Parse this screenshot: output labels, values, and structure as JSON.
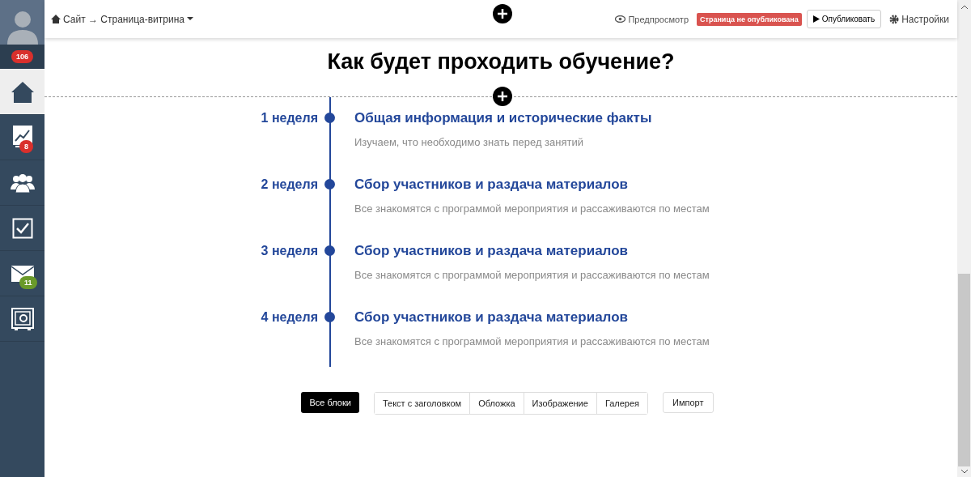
{
  "sidebar": {
    "avatar_badge": "106",
    "items": [
      {
        "kind": "home",
        "selected": true
      },
      {
        "kind": "chart",
        "selected": false,
        "badge": "8",
        "color": "#d9302c"
      },
      {
        "kind": "people",
        "selected": false
      },
      {
        "kind": "tasks",
        "selected": false
      },
      {
        "kind": "mail",
        "selected": false,
        "badge": "11",
        "color": "#6a9a2a"
      },
      {
        "kind": "safe",
        "selected": false
      }
    ]
  },
  "header": {
    "breadcrumb": "Сайт → Страница-витрина",
    "preview": "Предпросмотр",
    "status": "Страница не опубликована",
    "publish": "Опубликовать",
    "settings": "Настройки"
  },
  "section": {
    "title": "Как будет проходить обучение?"
  },
  "timeline": [
    {
      "week": "1 неделя",
      "title": "Общая информация и исторические факты",
      "text": "Изучаем, что необходимо знать перед занятий"
    },
    {
      "week": "2 неделя",
      "title": "Сбор участников и раздача материалов",
      "text": "Все знакомятся с программой мероприятия и рассаживаются по местам"
    },
    {
      "week": "3 неделя",
      "title": "Сбор участников и раздача материалов",
      "text": "Все знакомятся с программой мероприятия и рассаживаются по местам"
    },
    {
      "week": "4 неделя",
      "title": "Сбор участников и раздача материалов",
      "text": "Все знакомятся с программой мероприятия и рассаживаются по местам"
    }
  ],
  "block_filters": [
    {
      "label": "Все блоки",
      "selected": true
    },
    {
      "label": "Текст с заголовком",
      "selected": false
    },
    {
      "label": "Обложка",
      "selected": false
    },
    {
      "label": "Изображение",
      "selected": false
    },
    {
      "label": "Галерея",
      "selected": false
    }
  ],
  "import_button": "Импорт"
}
